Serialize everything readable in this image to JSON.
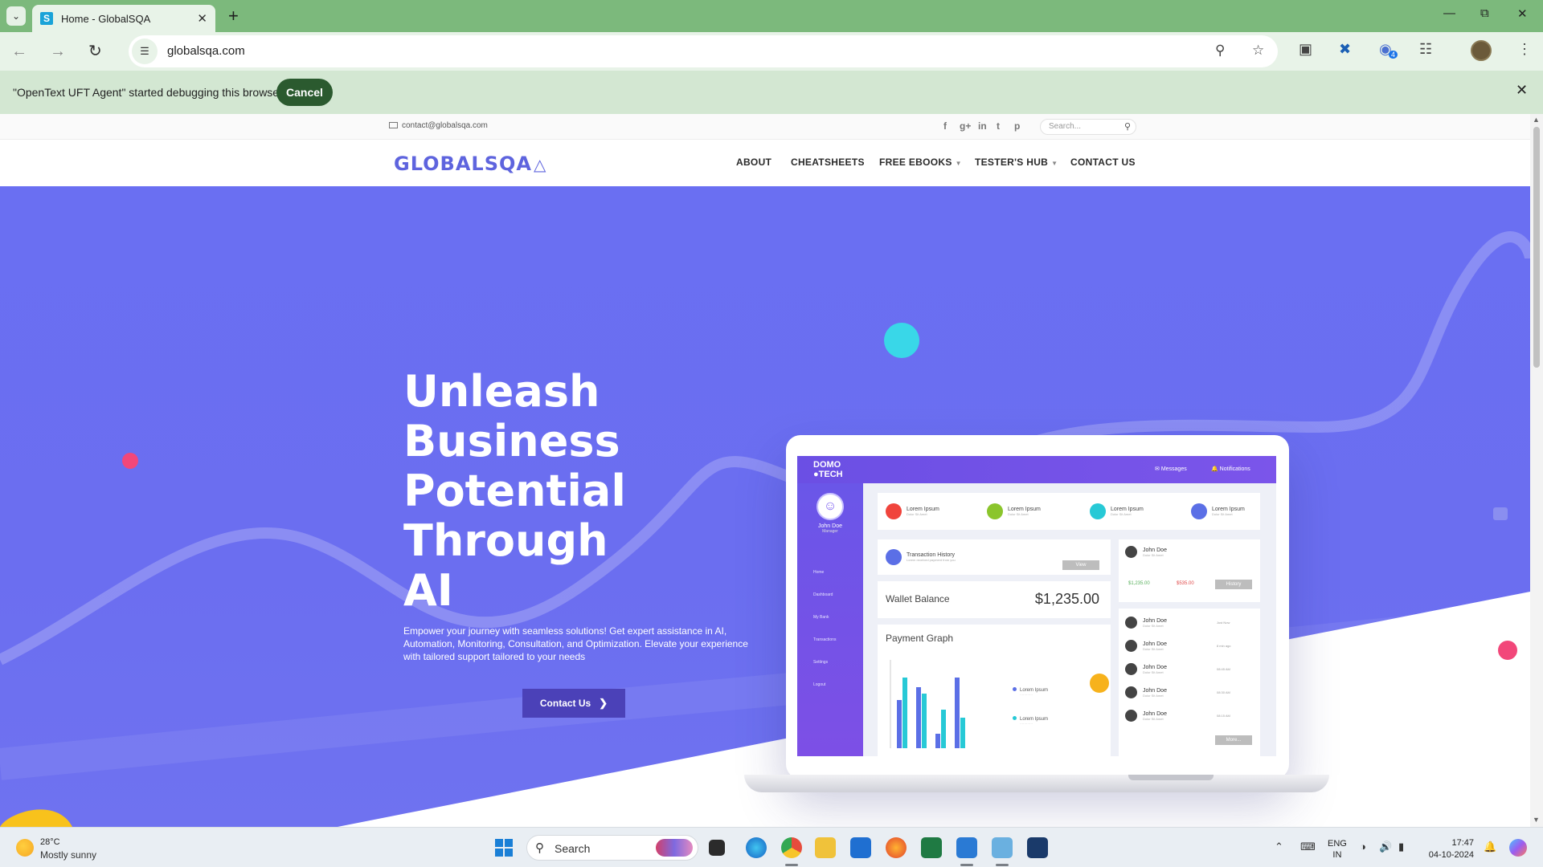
{
  "browser": {
    "tab_title": "Home - GlobalSQA",
    "favicon_letter": "S",
    "url": "globalsqa.com",
    "infobar_text": "\"OpenText UFT Agent\" started debugging this browser",
    "infobar_cancel": "Cancel",
    "extension_badge": "4",
    "icons": {
      "tab_list": "chevron-down-icon",
      "tab_close": "close-icon",
      "new_tab": "plus-icon",
      "back": "arrow-left-icon",
      "forward": "arrow-right-icon",
      "reload": "reload-icon",
      "zoom": "zoom-icon",
      "bookmark": "star-icon",
      "extensions": "puzzle-icon",
      "menu": "kebab-icon"
    }
  },
  "site": {
    "email": "contact@globalsqa.com",
    "social": [
      "f",
      "g+",
      "in",
      "t",
      "p"
    ],
    "search_placeholder": "Search...",
    "logo": "GLOBALSQA",
    "menu": [
      {
        "label": "ABOUT",
        "dropdown": false
      },
      {
        "label": "CHEATSHEETS",
        "dropdown": false
      },
      {
        "label": "FREE EBOOKS",
        "dropdown": true
      },
      {
        "label": "TESTER'S HUB",
        "dropdown": true
      },
      {
        "label": "CONTACT US",
        "dropdown": false
      }
    ],
    "hero": {
      "headline": [
        "Unleash",
        "Business",
        "Potential",
        "Through",
        "AI"
      ],
      "subtitle": "Empower your journey with seamless solutions! Get expert assistance in AI, Automation, Monitoring, Consultation, and Optimization. Elevate your experience with tailored support tailored to your needs",
      "cta": "Contact Us"
    },
    "mockup": {
      "brand": "DOMO\nTECH",
      "nav_messages": "Messages",
      "nav_notifications": "Notifications",
      "user_name": "John Doe",
      "user_role": "Manager",
      "side_menu": [
        "Home",
        "Dashboard",
        "My Bank",
        "Transactions",
        "Settings",
        "Logout"
      ],
      "stat_label": "Lorem Ipsum",
      "stat_sub": "Dolor Sit Amet",
      "stat_colors": [
        "#f0443c",
        "#8bc52c",
        "#27c9d6",
        "#5b6fe6"
      ],
      "transaction_title": "Transaction History",
      "transaction_sub": "Lorem received payment from you",
      "view_btn": "View",
      "person_name": "John Doe",
      "person_sub": "Dolor Sit Amet",
      "amount_up": "$1,235.00",
      "amount_down": "$535.00",
      "history_btn": "History",
      "wallet_label": "Wallet Balance",
      "wallet_value": "$1,235.00",
      "graph_title": "Payment Graph",
      "legend": [
        "Lorem Ipsum",
        "Lorem Ipsum"
      ],
      "legend_colors": [
        "#5b6fe6",
        "#27c9d6"
      ],
      "list_times": [
        "Just Now",
        "8 min ago",
        "08:45 AM",
        "08:30 AM",
        "08:15 AM"
      ],
      "more_btn": "More..."
    }
  },
  "taskbar": {
    "temperature": "28°C",
    "weather": "Mostly sunny",
    "search": "Search",
    "language_line1": "ENG",
    "language_line2": "IN",
    "time": "17:47",
    "date": "04-10-2024"
  }
}
